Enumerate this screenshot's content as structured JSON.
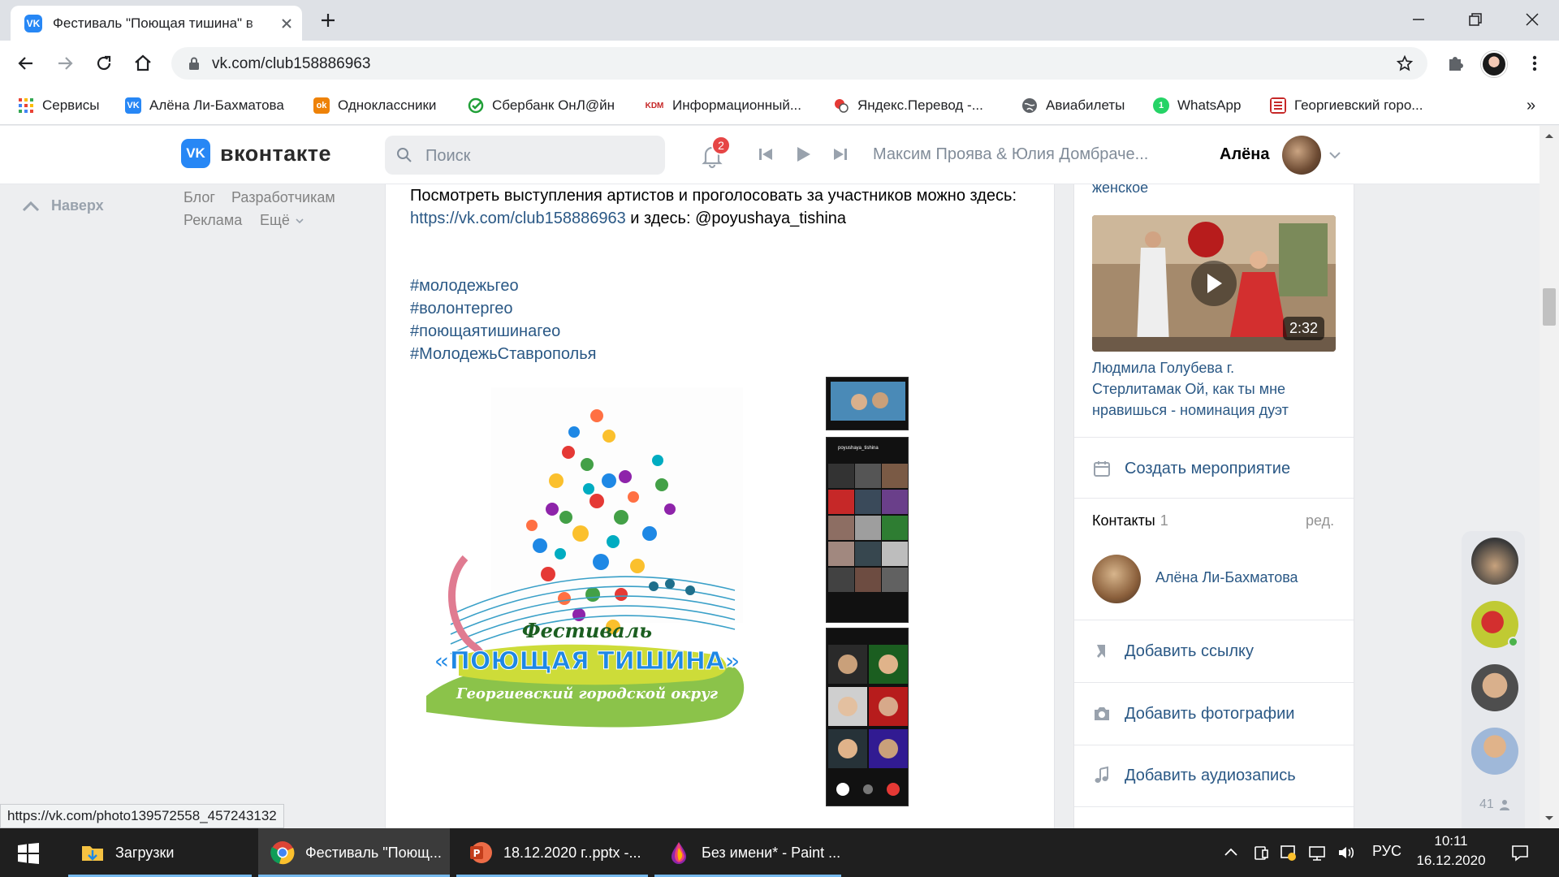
{
  "browser": {
    "tab_title": "Фестиваль \"Поющая тишина\" в",
    "url": "vk.com/club158886963",
    "bookmarks": [
      {
        "label": "Сервисы",
        "icon": "apps-grid-icon",
        "color": "#ea4335"
      },
      {
        "label": "Алёна Ли-Бахматова",
        "icon": "vk-icon",
        "color": "#2787f5"
      },
      {
        "label": "Одноклассники",
        "icon": "odnoklassniki-icon",
        "color": "#ee8208"
      },
      {
        "label": "Сбербанк ОнЛ@йн",
        "icon": "sberbank-icon",
        "color": "#21a038"
      },
      {
        "label": "Информационный...",
        "icon": "kdm-icon",
        "color": "#c62828"
      },
      {
        "label": "Яндекс.Перевод -...",
        "icon": "yandex-translate-icon",
        "color": "#e53935"
      },
      {
        "label": "Авиабилеты",
        "icon": "globe-icon",
        "color": "#5f6368"
      },
      {
        "label": "WhatsApp",
        "icon": "whatsapp-icon",
        "color": "#25d366"
      },
      {
        "label": "Георгиевский горо...",
        "icon": "georgievsk-icon",
        "color": "#c62828"
      }
    ],
    "more_bookmarks": "»"
  },
  "vk": {
    "logo_text": "вконтакте",
    "search_placeholder": "Поиск",
    "notifications_count": "2",
    "now_playing": "Максим Проява & Юлия Домбраче...",
    "user_name": "Алёна",
    "accent": "#2787f5",
    "link_color": "#2a5885"
  },
  "left": {
    "up_label": "Наверх",
    "footer_links": [
      "Блог",
      "Разработчикам",
      "Реклама",
      "Ещё"
    ]
  },
  "post": {
    "line1": "Посмотреть выступления артистов и проголосовать за участников можно здесь:",
    "link": "https://vk.com/club158886963",
    "line2_rest": " и здесь: @poyushaya_tishina",
    "hashtags": [
      "#молодежьгео",
      "#волонтергео",
      "#поющаятишинагео",
      "#МолодежьСтаврополья"
    ],
    "logo": {
      "line1": "Фестиваль",
      "line2": "«ПОЮЩАЯ ТИШИНА»",
      "line3": "Георгиевский городской округ"
    },
    "phone_header": "poyushaya_tishina"
  },
  "right": {
    "category_tail": "женское",
    "video": {
      "duration": "2:32",
      "caption_lines": [
        "Людмила Голубева г.",
        "Стерлитамак Ой, как ты мне",
        "нравишься - номинация дуэт"
      ]
    },
    "actions": {
      "create_event": "Создать мероприятие",
      "add_link": "Добавить ссылку",
      "add_photos": "Добавить фотографии",
      "add_audio": "Добавить аудиозапись"
    },
    "contacts": {
      "title": "Контакты",
      "count": "1",
      "edit": "ред.",
      "name": "Алёна Ли-Бахматова"
    }
  },
  "chats": {
    "count": "41"
  },
  "status_url": "https://vk.com/photo139572558_457243132",
  "taskbar": {
    "items": [
      {
        "label": "Загрузки",
        "icon": "folder-icon"
      },
      {
        "label": "Фестиваль \"Поющ...",
        "icon": "chrome-icon"
      },
      {
        "label": "18.12.2020 г..pptx -...",
        "icon": "powerpoint-icon"
      },
      {
        "label": "Без имени* - Paint ...",
        "icon": "paint-icon"
      }
    ],
    "lang": "РУС",
    "time": "10:11",
    "date": "16.12.2020"
  }
}
